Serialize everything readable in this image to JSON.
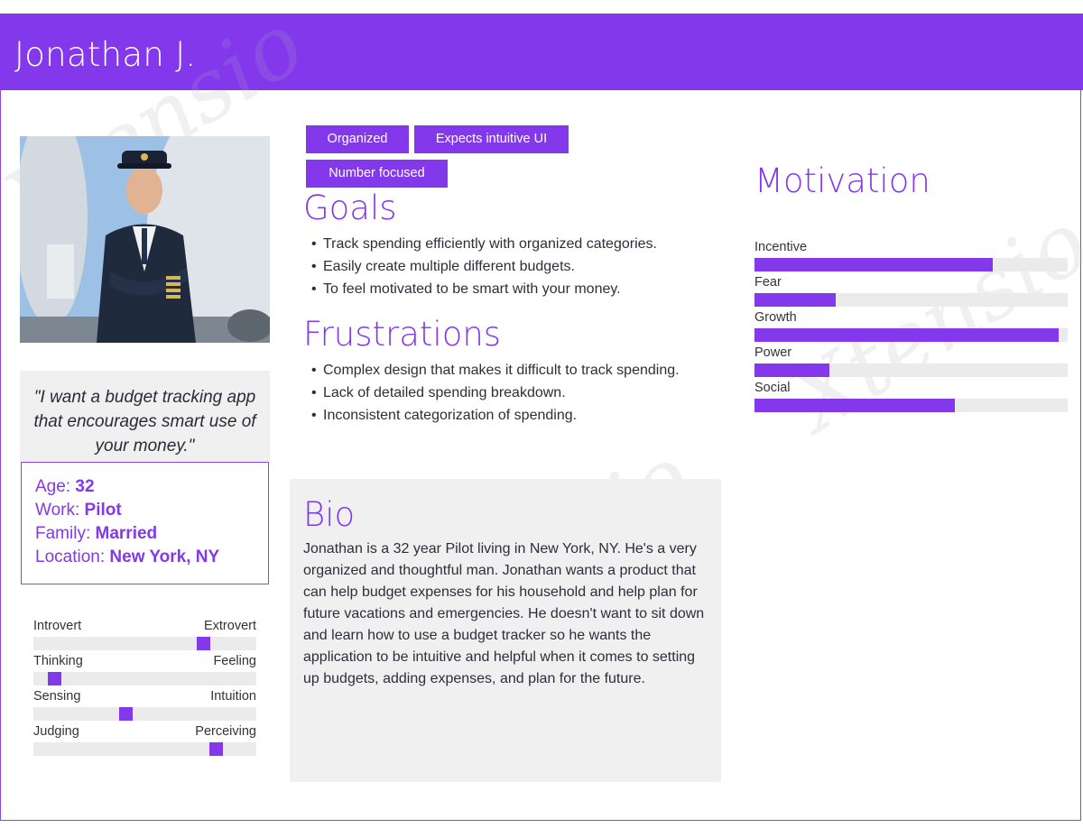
{
  "persona": {
    "name": "Jonathan J.",
    "quote": "\"I want a budget tracking app that encourages smart use of your money.\"",
    "info": {
      "age_label": "Age:",
      "age": "32",
      "work_label": "Work:",
      "work": "Pilot",
      "family_label": "Family:",
      "family": "Married",
      "location_label": "Location:",
      "location": "New York, NY"
    }
  },
  "traits": [
    {
      "left": "Introvert",
      "right": "Extrovert",
      "value": 0.78
    },
    {
      "left": "Thinking",
      "right": "Feeling",
      "value": 0.07
    },
    {
      "left": "Sensing",
      "right": "Intuition",
      "value": 0.41
    },
    {
      "left": "Judging",
      "right": "Perceiving",
      "value": 0.84
    }
  ],
  "tags": [
    "Organized",
    "Expects intuitive UI",
    "Number focused"
  ],
  "goals": {
    "title": "Goals",
    "items": [
      "Track spending efficiently with organized categories.",
      " Easily create multiple different budgets.",
      "To feel motivated to be smart with your money."
    ]
  },
  "frustrations": {
    "title": "Frustrations",
    "items": [
      "Complex design that makes it difficult to track spending.",
      "Lack of detailed spending breakdown.",
      "Inconsistent categorization of spending."
    ]
  },
  "bio": {
    "title": "Bio",
    "text": "Jonathan is a 32 year Pilot living in New York, NY. He's a very organized and thoughtful man. Jonathan wants a product that can help budget expenses for his household and help plan for future vacations and emergencies. He doesn't want to sit down and learn how to use a budget tracker so he wants the application to be intuitive and helpful when it comes to setting up budgets, adding expenses, and plan for the future."
  },
  "motivation": {
    "title": "Motivation",
    "items": [
      {
        "label": "Incentive",
        "value": 0.76
      },
      {
        "label": "Fear",
        "value": 0.26
      },
      {
        "label": "Growth",
        "value": 0.97
      },
      {
        "label": "Power",
        "value": 0.24
      },
      {
        "label": "Social",
        "value": 0.64
      }
    ]
  },
  "colors": {
    "accent": "#8338ec",
    "track": "#ebebeb",
    "panel": "#f0f0f0"
  }
}
